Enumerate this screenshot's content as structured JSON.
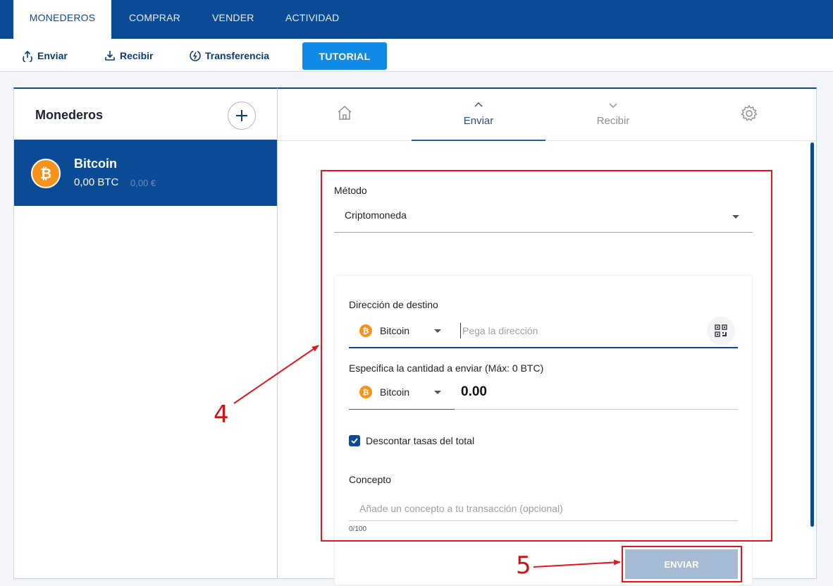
{
  "top_nav": {
    "tabs": [
      {
        "label": "MONEDEROS",
        "active": true
      },
      {
        "label": "COMPRAR",
        "active": false
      },
      {
        "label": "VENDER",
        "active": false
      },
      {
        "label": "ACTIVIDAD",
        "active": false
      }
    ]
  },
  "action_bar": {
    "send_label": "Enviar",
    "receive_label": "Recibir",
    "transfer_label": "Transferencia",
    "tutorial_label": "TUTORIAL"
  },
  "wallets_panel": {
    "title": "Monederos",
    "items": [
      {
        "name": "Bitcoin",
        "balance_crypto": "0,00 BTC",
        "balance_fiat": "0,00 €",
        "icon": "bitcoin-icon"
      }
    ]
  },
  "detail_tabs": {
    "home_icon": "home-icon",
    "send_label": "Enviar",
    "receive_label": "Recibir",
    "settings_icon": "gear-icon",
    "active": "send"
  },
  "send_form": {
    "method_label": "Método",
    "method_value": "Criptomoneda",
    "destination_label": "Dirección de destino",
    "destination_coin": "Bitcoin",
    "destination_placeholder": "Pega la dirección",
    "amount_label": "Especifica la cantidad a enviar (Máx: 0 BTC)",
    "amount_coin": "Bitcoin",
    "amount_value": "0.00",
    "deduct_fees_label": "Descontar tasas del total",
    "deduct_fees_checked": true,
    "concept_label": "Concepto",
    "concept_placeholder": "Añade un concepto a tu transacción (opcional)",
    "concept_counter": "0/100",
    "submit_label": "ENVIAR"
  },
  "annotations": {
    "form_marker": "4",
    "button_marker": "5",
    "color": "#e8141b"
  },
  "colors": {
    "brand_navy": "#0b4a94",
    "tutorial_blue": "#0f8ae6",
    "bitcoin_orange": "#f7931a",
    "disabled_button": "#a7bbd5"
  }
}
